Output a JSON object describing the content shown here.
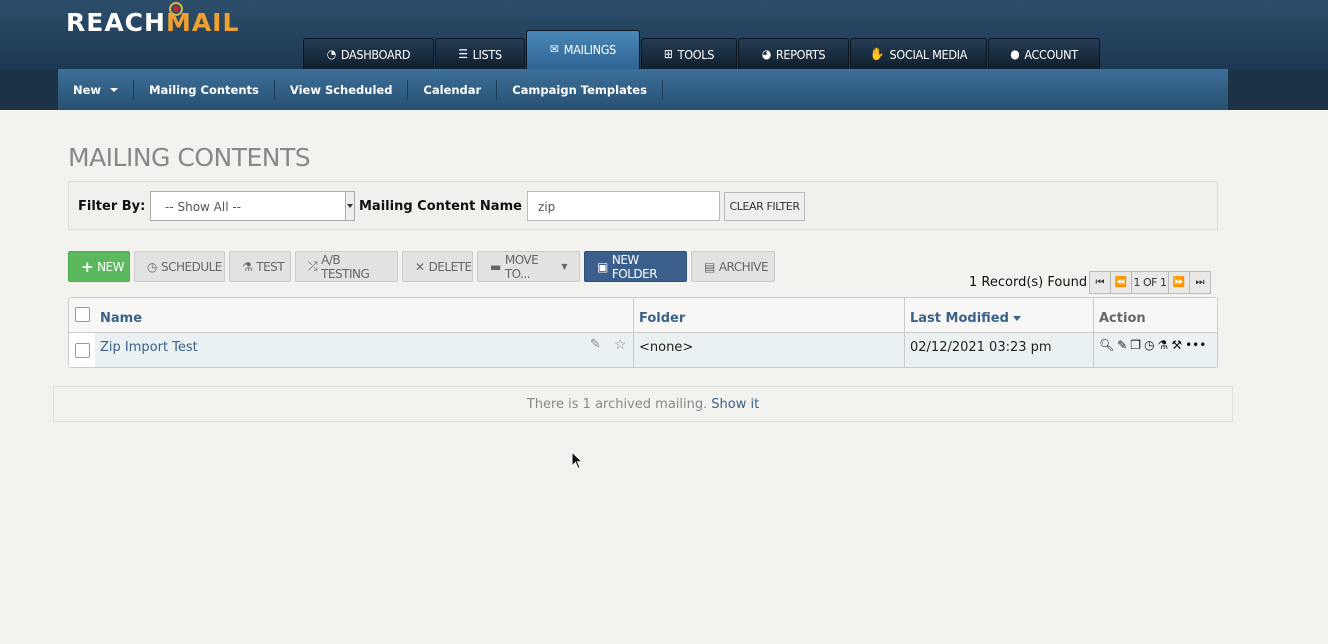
{
  "brand": {
    "part1": "REACH",
    "part2": "MAIL"
  },
  "nav": {
    "tabs": [
      {
        "label": "DASHBOARD",
        "icon": "dashboard-icon",
        "glyph": "◔"
      },
      {
        "label": "LISTS",
        "icon": "list-icon",
        "glyph": "☰"
      },
      {
        "label": "MAILINGS",
        "icon": "envelope-icon",
        "glyph": "✉"
      },
      {
        "label": "TOOLS",
        "icon": "toolbox-icon",
        "glyph": "⊞"
      },
      {
        "label": "REPORTS",
        "icon": "pie-chart-icon",
        "glyph": "◕"
      },
      {
        "label": "SOCIAL MEDIA",
        "icon": "thumbs-up-icon",
        "glyph": "👍"
      },
      {
        "label": "ACCOUNT",
        "icon": "user-icon",
        "glyph": "👤"
      }
    ],
    "active": "MAILINGS"
  },
  "subnav": {
    "items": [
      "New",
      "Mailing Contents",
      "View Scheduled",
      "Calendar",
      "Campaign Templates"
    ]
  },
  "page": {
    "title": "MAILING CONTENTS"
  },
  "filter": {
    "filter_by_label": "Filter By:",
    "filter_by_value": "-- Show All --",
    "name_label": "Mailing Content Name",
    "name_value": "zip",
    "clear_label": "CLEAR FILTER"
  },
  "toolbar": {
    "new": "NEW",
    "schedule": "SCHEDULE",
    "test": "TEST",
    "ab_testing": "A/B TESTING",
    "delete": "DELETE",
    "move_to": "MOVE TO...",
    "new_folder": "NEW FOLDER",
    "archive": "ARCHIVE"
  },
  "records": {
    "found_text": "1 Record(s) Found",
    "page_text": "1 OF 1"
  },
  "table": {
    "headers": {
      "name": "Name",
      "folder": "Folder",
      "last_modified": "Last Modified",
      "action": "Action"
    },
    "rows": [
      {
        "name": "Zip Import Test",
        "folder": "<none>",
        "last_modified": "02/12/2021 03:23 pm"
      }
    ],
    "action_icons": [
      "zoom-in-icon",
      "pencil-icon",
      "copy-icon",
      "clock-icon",
      "flask-icon",
      "gavel-icon",
      "ellipsis-icon"
    ]
  },
  "archived": {
    "text": "There is 1 archived mailing.",
    "link": "Show it"
  },
  "colors": {
    "accent_blue": "#3c618a",
    "brand_orange": "#f0a030",
    "new_green": "#5cb85c",
    "new_folder_blue": "#3b5f8d"
  }
}
